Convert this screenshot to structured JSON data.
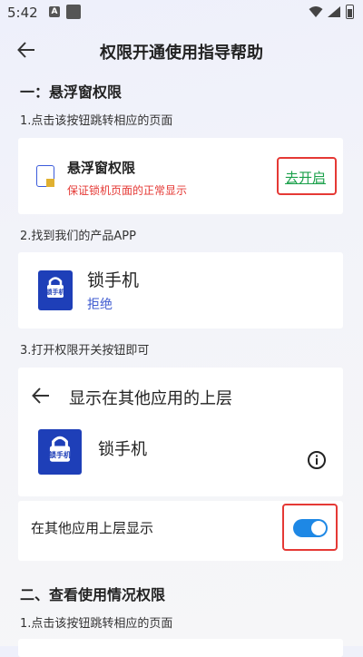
{
  "status_bar": {
    "time": "5:42",
    "notification_letter": "A"
  },
  "header": {
    "title": "权限开通使用指导帮助"
  },
  "sections": [
    {
      "heading": "一：悬浮窗权限",
      "step1": "1.点击该按钮跳转相应的页面",
      "permission_card": {
        "title": "悬浮窗权限",
        "subtitle": "保证锁机页面的正常显示",
        "button": "去开启"
      },
      "step2": "2.找到我们的产品APP",
      "app_card": {
        "icon_text": "锁手机",
        "name": "锁手机",
        "status": "拒绝"
      },
      "step3": "3.打开权限开关按钮即可",
      "settings_card": {
        "page_title": "显示在其他应用的上层",
        "icon_text": "锁手机",
        "app_name": "锁手机",
        "toggle_label": "在其他应用上层显示",
        "toggle_on": true
      }
    },
    {
      "heading": "二、查看使用情况权限",
      "step1": "1.点击该按钮跳转相应的页面"
    }
  ],
  "colors": {
    "accent_red": "#e53935",
    "link_green": "#1aa04a",
    "app_blue": "#1e3fb8",
    "toggle_blue": "#1e88e5",
    "status_blue": "#3f5bd0"
  }
}
